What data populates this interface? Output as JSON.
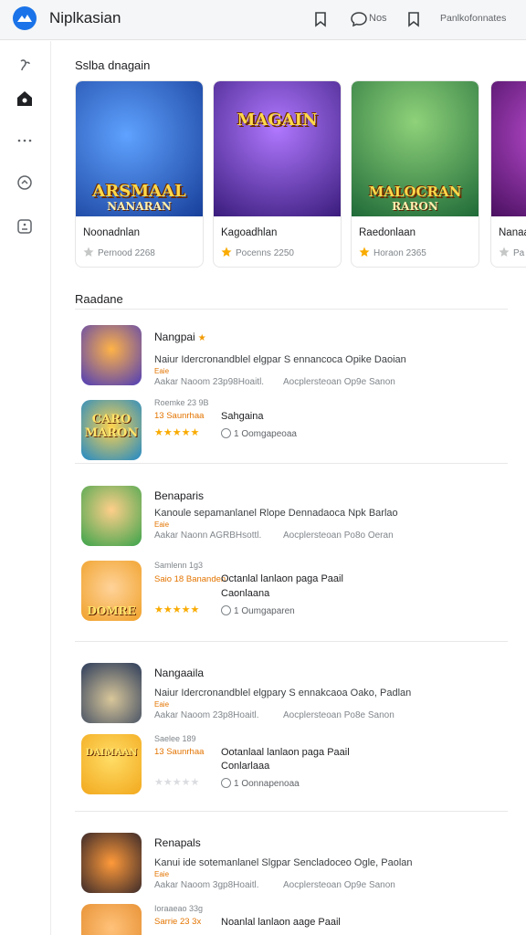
{
  "app": {
    "title": "Niplkasian"
  },
  "header": {
    "msg_label": "Nos",
    "profile_label": "Panlkofonnates"
  },
  "featured": {
    "title": "Sslba dnagain",
    "cards": [
      {
        "thumb_title": "ARSMAAL",
        "thumb_sub": "NANARAN",
        "name": "Noonadnlan",
        "rating": "Pernood 2268",
        "star_color": "#c4c7c5",
        "bg": "#2a63c9"
      },
      {
        "thumb_title": "MAGAIN",
        "thumb_sub": "",
        "name": "Kagoadhlan",
        "rating": "Pocenns 2250",
        "star_color": "#f9ab00",
        "bg": "#6a3aa8"
      },
      {
        "thumb_title": "MALOCRAN",
        "thumb_sub": "RARON",
        "name": "Raedonlaan",
        "rating": "Horaon 2365",
        "star_color": "#f9ab00",
        "bg": "#2f8a4a"
      },
      {
        "thumb_title": "",
        "thumb_sub": "",
        "name": "Nanaa",
        "rating": "Pa",
        "star_color": "#c4c7c5",
        "bg": "#7b2d8e"
      }
    ]
  },
  "list": {
    "title": "Raadane",
    "groups": [
      {
        "title": "Nangpai",
        "has_star": true,
        "desc": "Naiur Idercronandblel elgpar S ennancoca Opike Daoian",
        "mini": "Eaie",
        "meta": "Aakar Naoom 23p98Hoaitl.",
        "meta2": "Aocplersteoan Op9e Sanon",
        "icon1": "",
        "icon1_bg": "#4d3bb8",
        "sub_caption": "Roemke 23 9B",
        "sub_tag": "13 Saunrhaa",
        "sub_name": "Sahgaina",
        "sub_name2": "",
        "sub_foot": "1   Oomgapeoaa",
        "stars_on": 5,
        "icon2": "CARO MARON",
        "icon2_bg": "#1e88c8"
      },
      {
        "title": "Benaparis",
        "has_star": false,
        "desc": "Kanoule sepamanlanel Rlope Dennadaoca  Npk Barlao",
        "mini": "Eaie",
        "meta": "Aakar Naonn AGRBHsottl.",
        "meta2": "Aocplersteoan Po8o Oeran",
        "icon1": "",
        "icon1_bg": "#3aa34a",
        "sub_caption": "Samlenn 1g3",
        "sub_tag": "Saio 18 Bananden",
        "sub_name": "Octanlal lanlaon paga Paail",
        "sub_name2": "Caonlaana",
        "sub_foot": "1   Oumgaparen",
        "stars_on": 5,
        "icon2": "DOMRE",
        "icon2_bg": "#f0a12a"
      },
      {
        "title": "Nangaaila",
        "has_star": false,
        "desc": "Naiur Idercronandblel elgpary S ennakcaoa Oako, Padlan",
        "mini": "Eaie",
        "meta": "Aakar Naoom 23p8Hoaitl.",
        "meta2": "Aocplersteoan Po8e Sanon",
        "icon1": "",
        "icon1_bg": "#2b3b5a",
        "sub_caption": "Saelee 189",
        "sub_tag": "13 Saunrhaa",
        "sub_name": "Ootanlaal lanlaon paga Paail",
        "sub_name2": "Conlarlaaa",
        "sub_foot": "1   Oonnapenoaa",
        "stars_on": 0,
        "icon2": "DAIMAAN",
        "icon2_bg": "#f2a81d"
      },
      {
        "title": "Renapals",
        "has_star": false,
        "desc": "Kanui ide sotemanlanel Slgpar Sencladoceo Ogle, Paolan",
        "mini": "Eaie",
        "meta": "Aakar Naoom 3gp8Hoaitl.",
        "meta2": "Aocplersteoan Op9e Sanon",
        "icon1": "",
        "icon1_bg": "#3b2a2a",
        "sub_caption": "Ioraaeao 33g",
        "sub_tag": "Sarrie 23 3x",
        "sub_name": "Noanlal lanlaon aage Paail",
        "sub_name2": "",
        "sub_foot": "",
        "stars_on": 5,
        "icon2": "",
        "icon2_bg": "#e48a2a"
      }
    ]
  }
}
